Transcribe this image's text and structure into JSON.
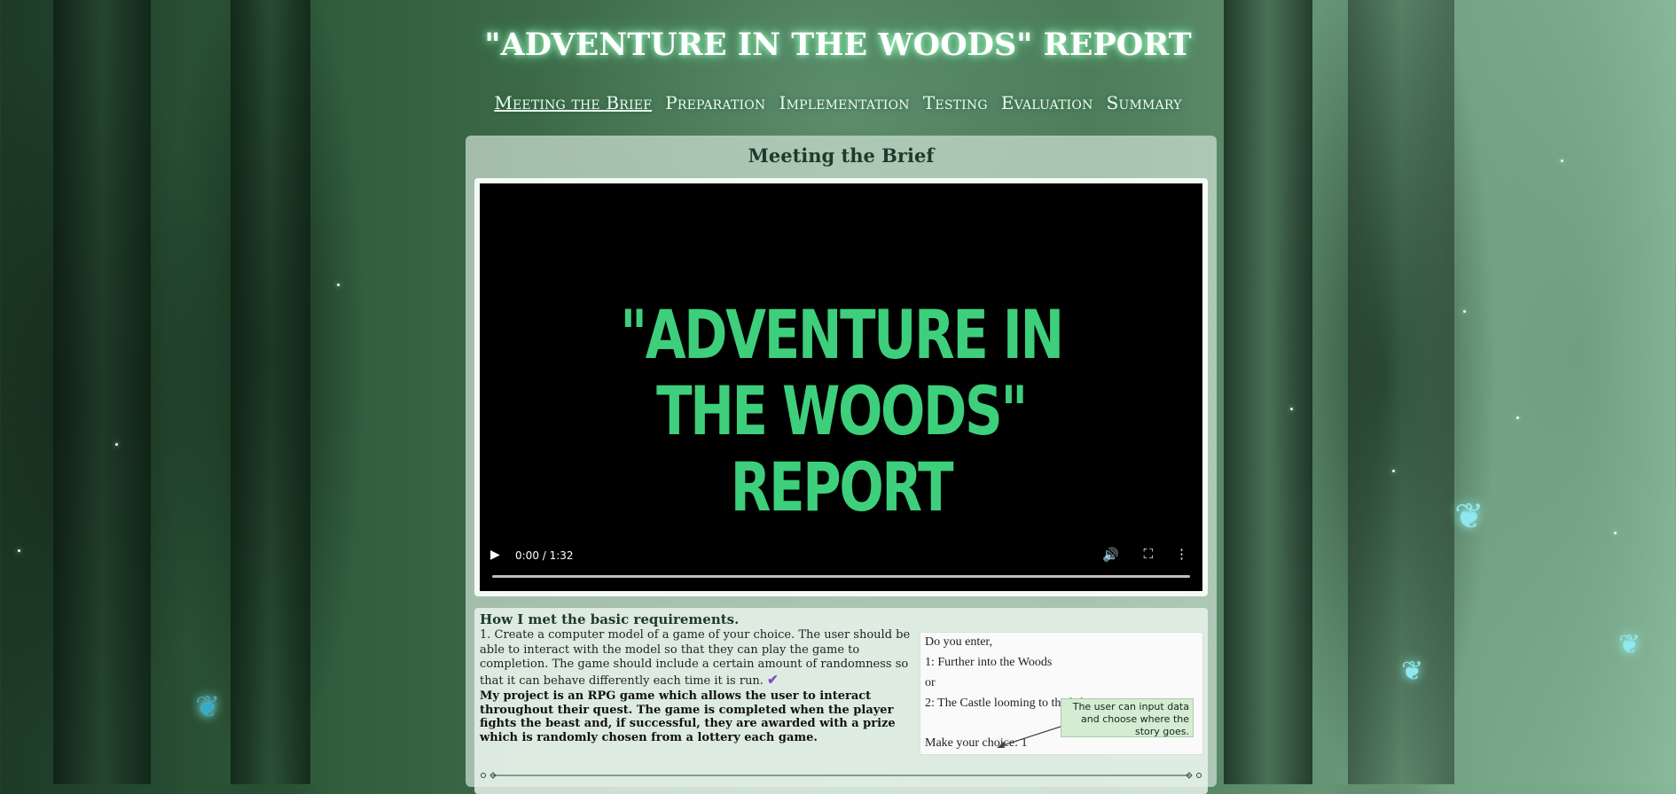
{
  "site": {
    "title": "\"ADVENTURE IN THE WOODS\" REPORT"
  },
  "nav": {
    "items": [
      {
        "label": "Meeting the Brief"
      },
      {
        "label": "Preparation"
      },
      {
        "label": "Implementation"
      },
      {
        "label": "Testing"
      },
      {
        "label": "Evaluation"
      },
      {
        "label": "Summary"
      }
    ]
  },
  "section": {
    "title": "Meeting the Brief"
  },
  "video": {
    "title_line1": "\"ADVENTURE IN",
    "title_line2": "THE WOODS\" REPORT",
    "time": "0:00 / 1:32",
    "progress": 0,
    "accent_color": "#3ecf7c"
  },
  "requirements": {
    "heading": "How I met the basic requirements.",
    "item1": "1. Create a computer model of a game of your choice. The user should be able to interact with the model so that they can play the game to completion. The game should include a certain amount of randomness so that it can behave differently each time it is run.",
    "answer": "My project is an RPG game which allows the user to interact throughout their quest. The game is completed when the player fights the beast and, if successful, they are awarded with a prize which is randomly chosen from a lottery each game."
  },
  "screenshot": {
    "line1": "Do you enter,",
    "line2": "1: Further into the Woods",
    "line3": "or",
    "line4": "2: The Castle looming to the left?",
    "line5": "Make your choice: 1",
    "callout": "The user can input data and choose where the story goes."
  }
}
